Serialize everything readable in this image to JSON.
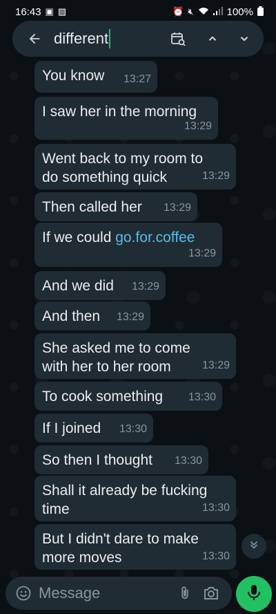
{
  "status_bar": {
    "time": "16:43",
    "battery": "100%"
  },
  "search": {
    "query": "different"
  },
  "messages": [
    {
      "text": "You know",
      "time": "13:27"
    },
    {
      "text": "I saw her in the morning",
      "time": "13:29"
    },
    {
      "line1": "Went back to my room to",
      "line2": "do something quick",
      "time": "13:29"
    },
    {
      "text": "Then called her",
      "time": "13:29"
    },
    {
      "prefix": "If we could ",
      "link": "go.for.coffee",
      "time": "13:29"
    },
    {
      "text": "And we did",
      "time": "13:29"
    },
    {
      "text": "And then",
      "time": "13:29"
    },
    {
      "line1": "She asked me to come",
      "line2": "with her to her room",
      "time": "13:29"
    },
    {
      "text": "To cook something",
      "time": "13:30"
    },
    {
      "text": "If I joined",
      "time": "13:30"
    },
    {
      "text": "So then I thought",
      "time": "13:30"
    },
    {
      "line1": "Shall it already be fucking",
      "line2": "time",
      "time": "13:30"
    },
    {
      "line1": "But I didn't dare to make",
      "line2": "more moves",
      "time": "13:30"
    }
  ],
  "composer": {
    "placeholder": "Message"
  },
  "colors": {
    "accent": "#21c063",
    "bubble": "#202c33",
    "link": "#53bdeb"
  },
  "icons": [
    "back-arrow-icon",
    "calendar-search-icon",
    "chevron-up-icon",
    "chevron-down-icon",
    "emoji-icon",
    "attach-icon",
    "camera-icon",
    "mic-icon",
    "scroll-down-icon"
  ]
}
